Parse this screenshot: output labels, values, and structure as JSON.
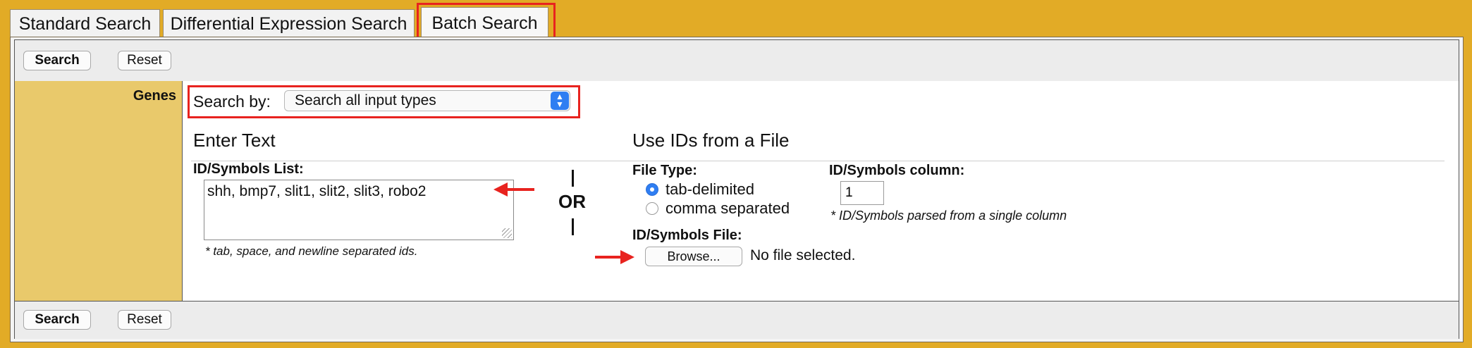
{
  "tabs": [
    {
      "label": "Standard Search",
      "active": false
    },
    {
      "label": "Differential Expression Search",
      "active": false
    },
    {
      "label": "Batch Search",
      "active": true
    }
  ],
  "toolbar": {
    "search_label": "Search",
    "reset_label": "Reset"
  },
  "genes": {
    "section_label": "Genes",
    "search_by_label": "Search by:",
    "search_by_value": "Search all input types",
    "enter_text": {
      "heading": "Enter Text",
      "list_label": "ID/Symbols List:",
      "list_value": "shh, bmp7, slit1, slit2, slit3, robo2",
      "hint": "* tab, space, and newline separated ids."
    },
    "or_label": "OR",
    "use_file": {
      "heading": "Use IDs from a File",
      "file_type_label": "File Type:",
      "file_type_options": [
        "tab-delimited",
        "comma separated"
      ],
      "selected_file_type": "tab-delimited",
      "column_label": "ID/Symbols column:",
      "column_value": "1",
      "column_hint": "* ID/Symbols parsed from a single column",
      "file_label": "ID/Symbols File:",
      "browse_label": "Browse...",
      "file_status": "No file selected."
    }
  },
  "colors": {
    "background": "#e2ab26",
    "label_column": "#e9c96b",
    "highlight": "#e8231f",
    "accent": "#2f7ef2"
  }
}
